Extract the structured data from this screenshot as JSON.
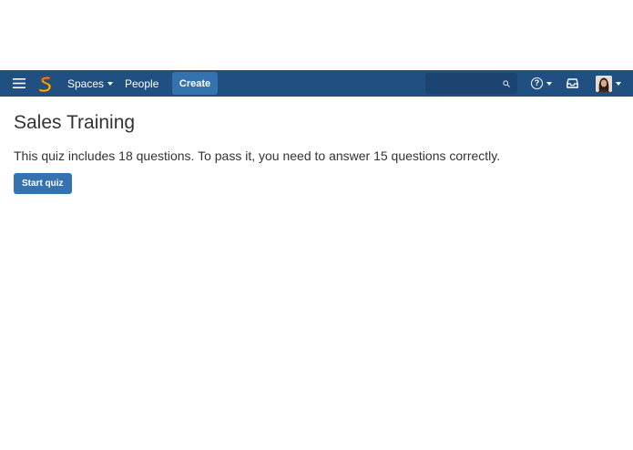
{
  "header": {
    "menu_icon": "hamburger-icon",
    "logo_icon": "confluence-s-logo-icon",
    "nav": {
      "spaces_label": "Spaces",
      "people_label": "People",
      "create_label": "Create"
    },
    "search": {
      "placeholder": "",
      "icon": "search-icon"
    },
    "help_icon": "help-icon",
    "notifications_icon": "notifications-icon",
    "user_icon": "avatar",
    "colors": {
      "bar": "#205081",
      "create_button": "#3572b0",
      "search_field": "#1b4570"
    }
  },
  "page": {
    "title": "Sales Training",
    "quiz_text": "This quiz includes 18 questions. To pass it, you need to answer 15 questions correctly.",
    "start_button_label": "Start quiz"
  }
}
